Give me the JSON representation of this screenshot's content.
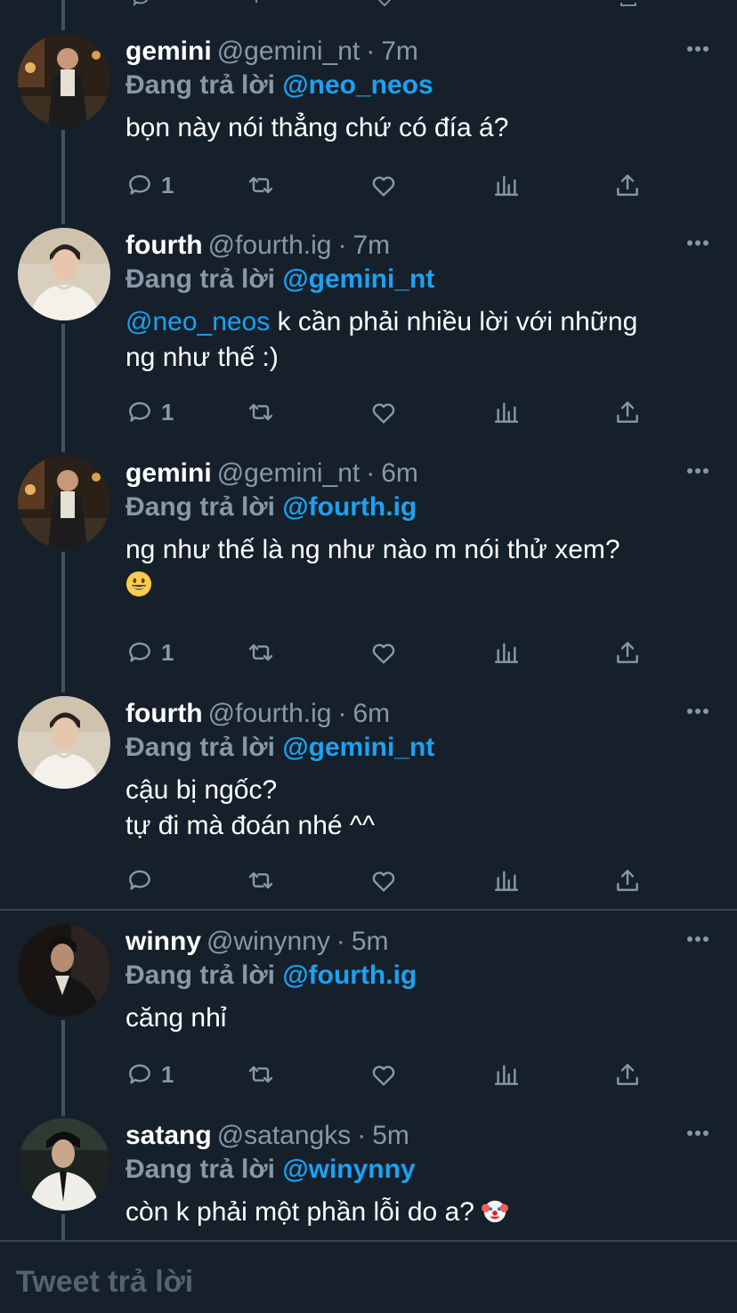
{
  "reply_label": "Đang trả lời",
  "colors": {
    "background": "#15202b",
    "accent": "#1da1f2",
    "muted": "#8899a6"
  },
  "tweets": [
    {
      "name": "gemini",
      "handle": "@gemini_nt",
      "separator": "·",
      "time": "7m",
      "reply_to": "@neo_neos",
      "lines": [
        {
          "segments": [
            {
              "text": "bọn này nói thẳng chứ có đía á?"
            }
          ]
        }
      ],
      "reply_count": "1"
    },
    {
      "name": "fourth",
      "handle": "@fourth.ig",
      "separator": "·",
      "time": "7m",
      "reply_to": "@gemini_nt",
      "lines": [
        {
          "segments": [
            {
              "text": "@neo_neos",
              "mention": true
            },
            {
              "text": " k cần phải nhiều lời với những"
            }
          ]
        },
        {
          "segments": [
            {
              "text": "ng như thế :)"
            }
          ]
        }
      ],
      "reply_count": "1"
    },
    {
      "name": "gemini",
      "handle": "@gemini_nt",
      "separator": "·",
      "time": "6m",
      "reply_to": "@fourth.ig",
      "lines": [
        {
          "segments": [
            {
              "text": "ng như thế là ng như nào m nói thử xem?"
            }
          ]
        },
        {
          "segments": [
            {
              "emoji": "grinning-face-emoji"
            }
          ]
        }
      ],
      "reply_count": "1"
    },
    {
      "name": "fourth",
      "handle": "@fourth.ig",
      "separator": "·",
      "time": "6m",
      "reply_to": "@gemini_nt",
      "lines": [
        {
          "segments": [
            {
              "text": "cậu bị ngốc?"
            }
          ]
        },
        {
          "segments": [
            {
              "text": "tự đi mà đoán nhé ^^"
            }
          ]
        }
      ],
      "reply_count": ""
    },
    {
      "name": "winny",
      "handle": "@winynny",
      "separator": "·",
      "time": "5m",
      "reply_to": "@fourth.ig",
      "lines": [
        {
          "segments": [
            {
              "text": "căng nhỉ"
            }
          ]
        }
      ],
      "reply_count": "1"
    },
    {
      "name": "satang",
      "handle": "@satangks",
      "separator": "·",
      "time": "5m",
      "reply_to": "@winynny",
      "lines": [
        {
          "segments": [
            {
              "text": "còn k phải một phần lỗi do a? "
            },
            {
              "emoji": "clown-face-emoji"
            }
          ]
        }
      ],
      "reply_count": ""
    }
  ],
  "composer": {
    "placeholder": "Tweet trả lời"
  }
}
